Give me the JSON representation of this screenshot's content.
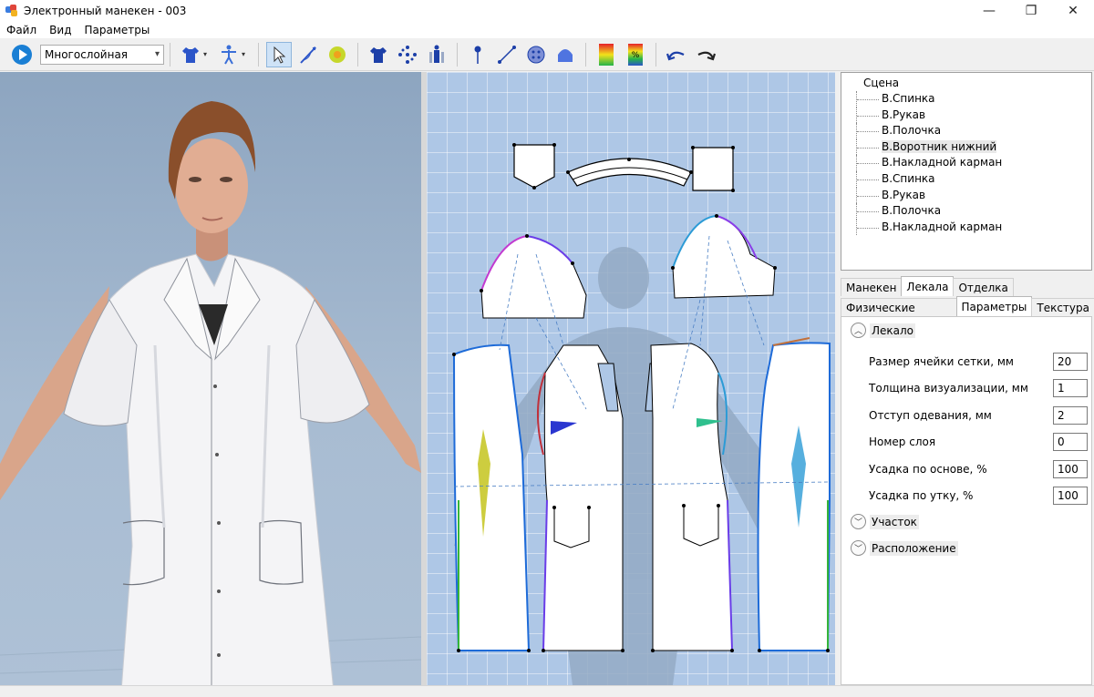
{
  "window": {
    "title": "Электронный манекен - 003",
    "minimize": "—",
    "restore": "❐",
    "close": "✕"
  },
  "menu": [
    "Файл",
    "Вид",
    "Параметры"
  ],
  "toolbar": {
    "layer_mode": "Многослойная",
    "dropdown_arrow": "▾"
  },
  "tree": {
    "root": "Сцена",
    "items": [
      "В.Спинка",
      "В.Рукав",
      "В.Полочка",
      "В.Воротник нижний",
      "В.Накладной карман",
      "В.Спинка",
      "В.Рукав",
      "В.Полочка",
      "В.Накладной карман"
    ],
    "selected_index": 3
  },
  "tabs_top": [
    "Манекен",
    "Лекала",
    "Отделка"
  ],
  "tabs_top_active": 1,
  "tabs_sub": [
    "Физические свойства",
    "Параметры",
    "Текстура"
  ],
  "tabs_sub_active": 1,
  "sections": {
    "lekalo": "Лекало",
    "uchastok": "Участок",
    "raspolozhenie": "Расположение"
  },
  "params": [
    {
      "label": "Размер ячейки сетки, мм",
      "value": "20"
    },
    {
      "label": "Толщина визуализации, мм",
      "value": "1"
    },
    {
      "label": "Отступ одевания, мм",
      "value": "2"
    },
    {
      "label": "Номер слоя",
      "value": "0"
    },
    {
      "label": "Усадка по основе, %",
      "value": "100"
    },
    {
      "label": "Усадка по утку, %",
      "value": "100"
    }
  ],
  "colors": {
    "accent_blue": "#1a7fd4",
    "selection_bg": "#cfe3f7",
    "view3d_bg": "#97adc6",
    "view2d_bg": "#aec7e6"
  }
}
